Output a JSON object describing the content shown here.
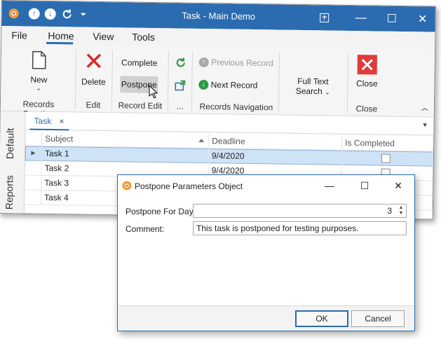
{
  "window": {
    "title": "Task - Main Demo"
  },
  "menu": {
    "items": [
      "File",
      "Home",
      "View",
      "Tools"
    ],
    "active": "Home"
  },
  "ribbon": {
    "new_label": "New",
    "delete_label": "Delete",
    "complete_label": "Complete",
    "postpone_label": "Postpone",
    "previous_record_label": "Previous Record",
    "next_record_label": "Next Record",
    "full_text_search_line1": "Full Text",
    "full_text_search_line2": "Search",
    "close_label": "Close",
    "groups": {
      "records_creation": "Records Creation",
      "edit": "Edit",
      "record_edit": "Record Edit",
      "more": "...",
      "records_navigation": "Records Navigation",
      "close": "Close"
    },
    "colors": {
      "delete_red": "#d62b2b",
      "refresh_green": "#2f9a45",
      "close_red": "#e03a3a",
      "accent_blue": "#2b6cb0"
    }
  },
  "document_tabs": [
    {
      "label": "Task",
      "close": "×"
    }
  ],
  "side_tabs": [
    "Default",
    "Reports"
  ],
  "grid": {
    "columns": [
      "Subject",
      "Deadline",
      "Is Completed"
    ],
    "rows": [
      {
        "subject": "Task 1",
        "deadline": "9/4/2020",
        "completed": false,
        "selected": true
      },
      {
        "subject": "Task 2",
        "deadline": "9/4/2020",
        "completed": false,
        "selected": false
      },
      {
        "subject": "Task 3",
        "deadline": "",
        "completed": false,
        "selected": false
      },
      {
        "subject": "Task 4",
        "deadline": "",
        "completed": false,
        "selected": false
      }
    ]
  },
  "dialog": {
    "title": "Postpone Parameters Object",
    "postpone_label": "Postpone For Days:",
    "postpone_value": "3",
    "comment_label": "Comment:",
    "comment_value": "This task is postponed for testing purposes.",
    "ok_label": "OK",
    "cancel_label": "Cancel"
  }
}
